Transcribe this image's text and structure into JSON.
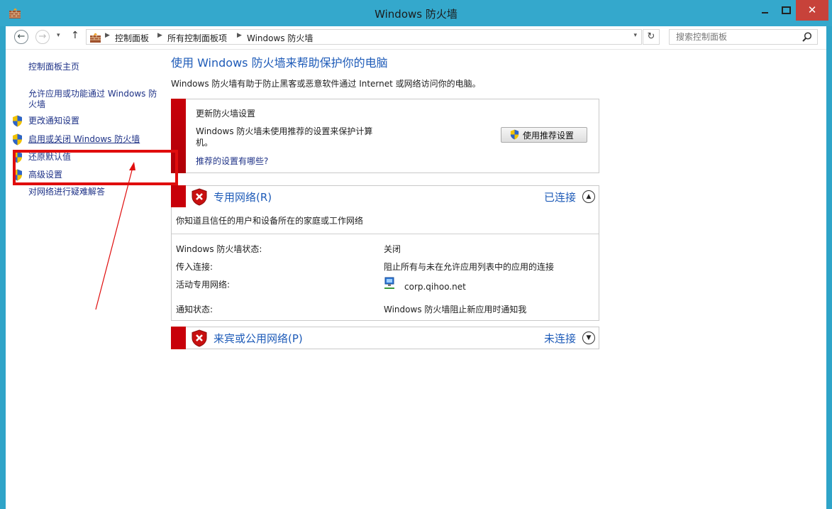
{
  "window": {
    "title": "Windows 防火墙",
    "close_glyph": "✕"
  },
  "nav": {
    "back_glyph": "←",
    "forward_glyph": "→",
    "up_glyph": "↑",
    "dropdown_glyph": "▾",
    "refresh_glyph": "↻",
    "breadcrumb": [
      "控制面板",
      "所有控制面板项",
      "Windows 防火墙"
    ],
    "search_placeholder": "搜索控制面板"
  },
  "sidebar": {
    "items": [
      {
        "label": "控制面板主页",
        "icon": null
      },
      {
        "label": "允许应用或功能通过 Windows 防火墙",
        "icon": null
      },
      {
        "label": "更改通知设置",
        "icon": "uac-shield-icon"
      },
      {
        "label": "启用或关闭 Windows 防火墙",
        "icon": "uac-shield-icon"
      },
      {
        "label": "还原默认值",
        "icon": "uac-shield-icon"
      },
      {
        "label": "高级设置",
        "icon": "uac-shield-icon"
      },
      {
        "label": "对网络进行疑难解答",
        "icon": null
      }
    ]
  },
  "main": {
    "heading": "使用 Windows 防火墙来帮助保护你的电脑",
    "description": "Windows 防火墙有助于防止黑客或恶意软件通过 Internet 或网络访问你的电脑。",
    "update_panel": {
      "title": "更新防火墙设置",
      "text": "Windows 防火墙未使用推荐的设置来保护计算机。",
      "link": "推荐的设置有哪些?",
      "button": "使用推荐设置"
    },
    "private_network": {
      "title": "专用网络(R)",
      "status": "已连接",
      "description": "你知道且信任的用户和设备所在的家庭或工作网络",
      "rows": [
        {
          "label": "Windows 防火墙状态:",
          "value": "关闭"
        },
        {
          "label": "传入连接:",
          "value": "阻止所有与未在允许应用列表中的应用的连接"
        },
        {
          "label": "活动专用网络:",
          "value": "corp.qihoo.net"
        },
        {
          "label": "通知状态:",
          "value": "Windows 防火墙阻止新应用时通知我"
        }
      ]
    },
    "public_network": {
      "title": "来宾或公用网络(P)",
      "status": "未连接"
    }
  },
  "colors": {
    "accent_blue": "#1e5bb8",
    "link_blue": "#1e3287",
    "warning_red": "#c8000a",
    "annotation_red": "#e00d0d",
    "titlebar": "#34a8cc"
  }
}
